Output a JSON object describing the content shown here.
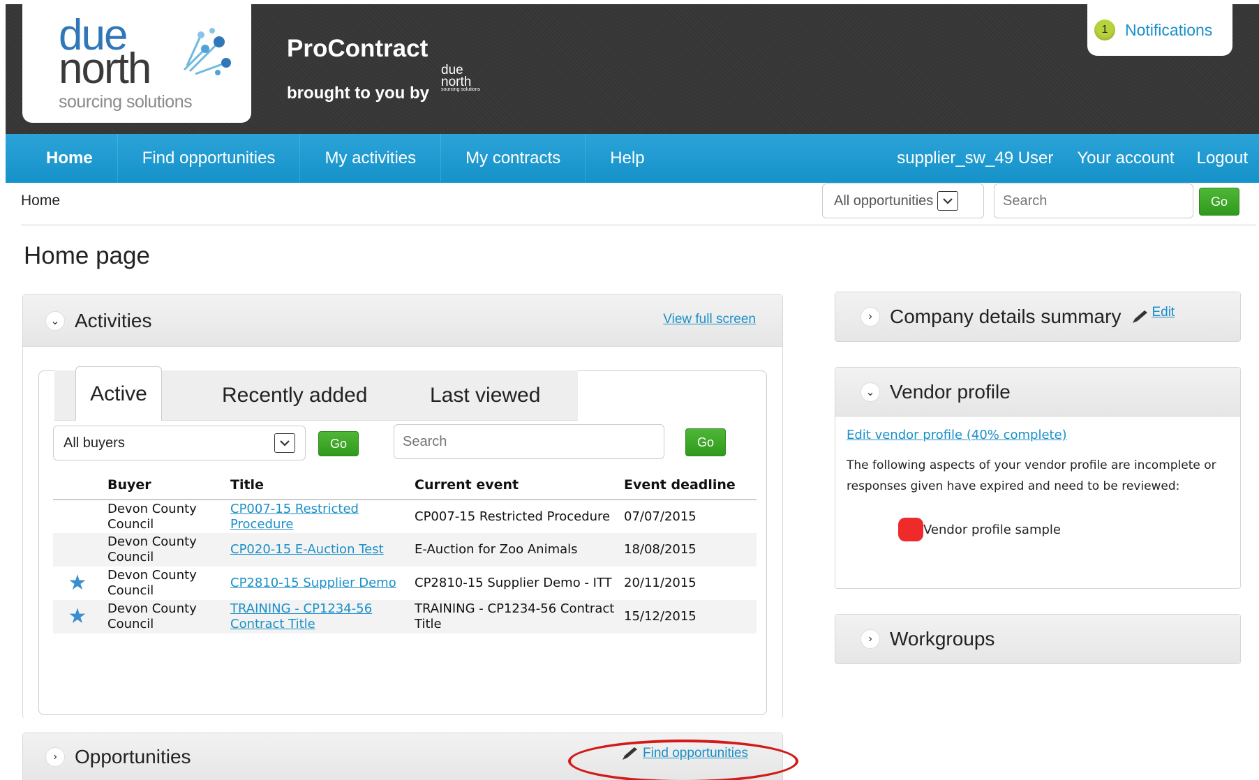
{
  "header": {
    "logo": {
      "line1": "due",
      "line2": "north",
      "tagline": "sourcing solutions"
    },
    "app_title": "ProContract",
    "subtitle": "brought to you by",
    "mini_logo": {
      "line1": "due",
      "line2": "north",
      "tagline": "sourcing solutions"
    },
    "notifications": {
      "count": "1",
      "label": "Notifications"
    }
  },
  "nav": {
    "items": [
      "Home",
      "Find opportunities",
      "My activities",
      "My contracts",
      "Help"
    ],
    "user": "supplier_sw_49 User",
    "account": "Your account",
    "logout": "Logout"
  },
  "breadcrumb": "Home",
  "top_search": {
    "scope": "All opportunities",
    "placeholder": "Search",
    "go": "Go"
  },
  "page_title": "Home page",
  "activities": {
    "title": "Activities",
    "view_full": "View full screen",
    "tabs": [
      "Active",
      "Recently added",
      "Last viewed"
    ],
    "buyer_filter": "All buyers",
    "go": "Go",
    "search_placeholder": "Search",
    "columns": [
      "Buyer",
      "Title",
      "Current event",
      "Event deadline"
    ],
    "rows": [
      {
        "starred": false,
        "buyer": "Devon County Council",
        "title": "CP007-15 Restricted Procedure",
        "event": "CP007-15 Restricted Procedure",
        "deadline": "07/07/2015"
      },
      {
        "starred": false,
        "buyer": "Devon County Council",
        "title": "CP020-15 E-Auction Test",
        "event": "E-Auction for Zoo Animals",
        "deadline": "18/08/2015"
      },
      {
        "starred": true,
        "buyer": "Devon County Council",
        "title": "CP2810-15 Supplier Demo",
        "event": "CP2810-15 Supplier Demo - ITT",
        "deadline": "20/11/2015"
      },
      {
        "starred": true,
        "buyer": "Devon County Council",
        "title": "TRAINING - CP1234-56 Contract Title",
        "event": "TRAINING - CP1234-56 Contract Title",
        "deadline": "15/12/2015"
      }
    ]
  },
  "opportunities": {
    "title": "Opportunities",
    "link": "Find opportunities"
  },
  "company": {
    "title": "Company details summary",
    "edit": "Edit"
  },
  "vendor": {
    "title": "Vendor profile",
    "link": "Edit vendor profile (40% complete)",
    "text": "The following aspects of your vendor profile are incomplete or responses given have expired and need to be reviewed:",
    "item": "Vendor profile sample"
  },
  "workgroups": {
    "title": "Workgroups"
  },
  "colors": {
    "nav": "#1b98cf",
    "link": "#1a8fc8",
    "go": "#3aa526",
    "badge": "#b7d33c",
    "alert": "#ee2a2a"
  }
}
